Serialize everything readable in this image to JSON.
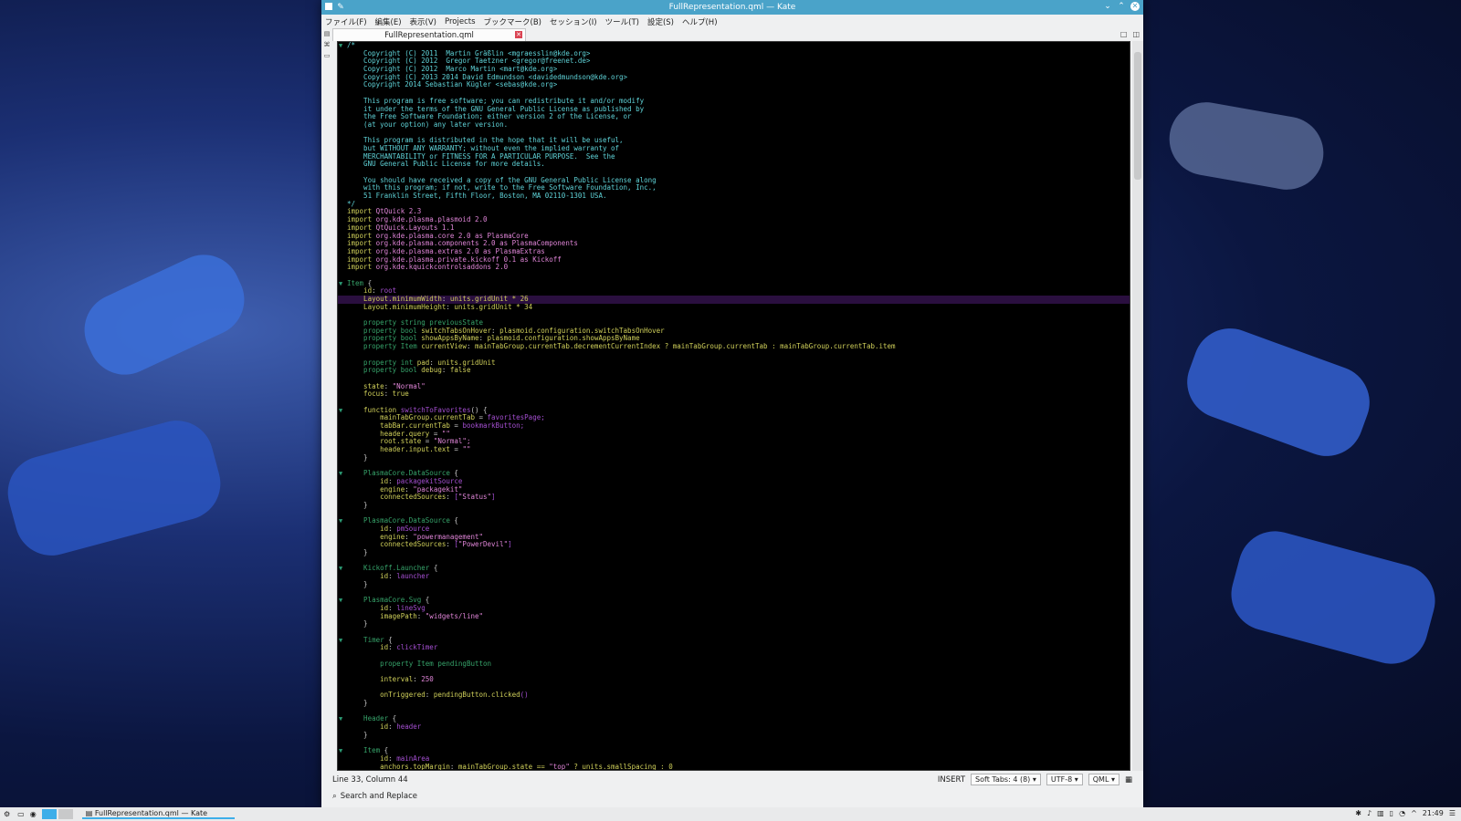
{
  "window": {
    "title": "FullRepresentation.qml — Kate"
  },
  "menu": [
    "ファイル(F)",
    "編集(E)",
    "表示(V)",
    "Projects",
    "ブックマーク(B)",
    "セッション(I)",
    "ツール(T)",
    "設定(S)",
    "ヘルプ(H)"
  ],
  "tab": {
    "label": "FullRepresentation.qml"
  },
  "code_lines": [
    {
      "fold": true,
      "cur": false,
      "segs": [
        {
          "c": "c",
          "t": "/*"
        }
      ]
    },
    {
      "segs": [
        {
          "c": "c",
          "t": "    Copyright (C) 2011  Martin Gräßlin <mgraesslin@kde.org>"
        }
      ]
    },
    {
      "segs": [
        {
          "c": "c",
          "t": "    Copyright (C) 2012  Gregor Taetzner <gregor@freenet.de>"
        }
      ]
    },
    {
      "segs": [
        {
          "c": "c",
          "t": "    Copyright (C) 2012  Marco Martin <mart@kde.org>"
        }
      ]
    },
    {
      "segs": [
        {
          "c": "c",
          "t": "    Copyright (C) 2013 2014 David Edmundson <davidedmundson@kde.org>"
        }
      ]
    },
    {
      "segs": [
        {
          "c": "c",
          "t": "    Copyright 2014 Sebastian Kügler <sebas@kde.org>"
        }
      ]
    },
    {
      "segs": [
        {
          "c": "c",
          "t": ""
        }
      ]
    },
    {
      "segs": [
        {
          "c": "c",
          "t": "    This program is free software; you can redistribute it and/or modify"
        }
      ]
    },
    {
      "segs": [
        {
          "c": "c",
          "t": "    it under the terms of the GNU General Public License as published by"
        }
      ]
    },
    {
      "segs": [
        {
          "c": "c",
          "t": "    the Free Software Foundation; either version 2 of the License, or"
        }
      ]
    },
    {
      "segs": [
        {
          "c": "c",
          "t": "    (at your option) any later version."
        }
      ]
    },
    {
      "segs": [
        {
          "c": "c",
          "t": ""
        }
      ]
    },
    {
      "segs": [
        {
          "c": "c",
          "t": "    This program is distributed in the hope that it will be useful,"
        }
      ]
    },
    {
      "segs": [
        {
          "c": "c",
          "t": "    but WITHOUT ANY WARRANTY; without even the implied warranty of"
        }
      ]
    },
    {
      "segs": [
        {
          "c": "c",
          "t": "    MERCHANTABILITY or FITNESS FOR A PARTICULAR PURPOSE.  See the"
        }
      ]
    },
    {
      "segs": [
        {
          "c": "c",
          "t": "    GNU General Public License for more details."
        }
      ]
    },
    {
      "segs": [
        {
          "c": "c",
          "t": ""
        }
      ]
    },
    {
      "segs": [
        {
          "c": "c",
          "t": "    You should have received a copy of the GNU General Public License along"
        }
      ]
    },
    {
      "segs": [
        {
          "c": "c",
          "t": "    with this program; if not, write to the Free Software Foundation, Inc.,"
        }
      ]
    },
    {
      "segs": [
        {
          "c": "c",
          "t": "    51 Franklin Street, Fifth Floor, Boston, MA 02110-1301 USA."
        }
      ]
    },
    {
      "segs": [
        {
          "c": "c",
          "t": "*/"
        }
      ]
    },
    {
      "segs": [
        {
          "c": "k",
          "t": "import "
        },
        {
          "c": "s",
          "t": "QtQuick 2.3"
        }
      ]
    },
    {
      "segs": [
        {
          "c": "k",
          "t": "import "
        },
        {
          "c": "s",
          "t": "org.kde.plasma.plasmoid 2.0"
        }
      ]
    },
    {
      "segs": [
        {
          "c": "k",
          "t": "import "
        },
        {
          "c": "s",
          "t": "QtQuick.Layouts 1.1"
        }
      ]
    },
    {
      "segs": [
        {
          "c": "k",
          "t": "import "
        },
        {
          "c": "s",
          "t": "org.kde.plasma.core 2.0 as PlasmaCore"
        }
      ]
    },
    {
      "segs": [
        {
          "c": "k",
          "t": "import "
        },
        {
          "c": "s",
          "t": "org.kde.plasma.components 2.0 as PlasmaComponents"
        }
      ]
    },
    {
      "segs": [
        {
          "c": "k",
          "t": "import "
        },
        {
          "c": "s",
          "t": "org.kde.plasma.extras 2.0 as PlasmaExtras"
        }
      ]
    },
    {
      "segs": [
        {
          "c": "k",
          "t": "import "
        },
        {
          "c": "s",
          "t": "org.kde.plasma.private.kickoff 0.1 as Kickoff"
        }
      ]
    },
    {
      "segs": [
        {
          "c": "k",
          "t": "import "
        },
        {
          "c": "s",
          "t": "org.kde.kquickcontrolsaddons 2.0"
        }
      ]
    },
    {
      "segs": [
        {
          "c": "w",
          "t": ""
        }
      ]
    },
    {
      "fold": true,
      "segs": [
        {
          "c": "g",
          "t": "Item "
        },
        {
          "c": "w",
          "t": "{"
        }
      ]
    },
    {
      "segs": [
        {
          "c": "k",
          "t": "    id"
        },
        {
          "c": "w",
          "t": ": "
        },
        {
          "c": "p",
          "t": "root"
        }
      ]
    },
    {
      "cur": true,
      "segs": [
        {
          "c": "k",
          "t": "    Layout.minimumWidth"
        },
        {
          "c": "w",
          "t": ": "
        },
        {
          "c": "k",
          "t": "units.gridUnit * 26"
        }
      ]
    },
    {
      "segs": [
        {
          "c": "k",
          "t": "    Layout.minimumHeight"
        },
        {
          "c": "w",
          "t": ": "
        },
        {
          "c": "k",
          "t": "units.gridUnit * 34"
        }
      ]
    },
    {
      "segs": [
        {
          "c": "w",
          "t": ""
        }
      ]
    },
    {
      "segs": [
        {
          "c": "g",
          "t": "    property string previousState"
        }
      ]
    },
    {
      "segs": [
        {
          "c": "g",
          "t": "    property bool "
        },
        {
          "c": "k",
          "t": "switchTabsOnHover"
        },
        {
          "c": "w",
          "t": ": "
        },
        {
          "c": "k",
          "t": "plasmoid.configuration.switchTabsOnHover"
        }
      ]
    },
    {
      "segs": [
        {
          "c": "g",
          "t": "    property bool "
        },
        {
          "c": "k",
          "t": "showAppsByName"
        },
        {
          "c": "w",
          "t": ": "
        },
        {
          "c": "k",
          "t": "plasmoid.configuration.showAppsByName"
        }
      ]
    },
    {
      "segs": [
        {
          "c": "g",
          "t": "    property Item "
        },
        {
          "c": "k",
          "t": "currentView"
        },
        {
          "c": "w",
          "t": ": "
        },
        {
          "c": "k",
          "t": "mainTabGroup.currentTab.decrementCurrentIndex ? mainTabGroup.currentTab : mainTabGroup.currentTab.item"
        }
      ]
    },
    {
      "segs": [
        {
          "c": "w",
          "t": ""
        }
      ]
    },
    {
      "segs": [
        {
          "c": "g",
          "t": "    property int "
        },
        {
          "c": "k",
          "t": "pad"
        },
        {
          "c": "w",
          "t": ": "
        },
        {
          "c": "k",
          "t": "units.gridUnit"
        }
      ]
    },
    {
      "segs": [
        {
          "c": "g",
          "t": "    property bool "
        },
        {
          "c": "k",
          "t": "debug"
        },
        {
          "c": "w",
          "t": ": "
        },
        {
          "c": "k",
          "t": "false"
        }
      ]
    },
    {
      "segs": [
        {
          "c": "w",
          "t": ""
        }
      ]
    },
    {
      "segs": [
        {
          "c": "k",
          "t": "    state"
        },
        {
          "c": "w",
          "t": ": "
        },
        {
          "c": "s",
          "t": "\"Normal\""
        }
      ]
    },
    {
      "segs": [
        {
          "c": "k",
          "t": "    focus"
        },
        {
          "c": "w",
          "t": ": "
        },
        {
          "c": "k",
          "t": "true"
        }
      ]
    },
    {
      "segs": [
        {
          "c": "w",
          "t": ""
        }
      ]
    },
    {
      "fold": true,
      "segs": [
        {
          "c": "k",
          "t": "    function "
        },
        {
          "c": "p",
          "t": "switchToFavorites"
        },
        {
          "c": "w",
          "t": "() {"
        }
      ]
    },
    {
      "segs": [
        {
          "c": "k",
          "t": "        mainTabGroup.currentTab"
        },
        {
          "c": "w",
          "t": " = "
        },
        {
          "c": "p",
          "t": "favoritesPage;"
        }
      ]
    },
    {
      "segs": [
        {
          "c": "k",
          "t": "        tabBar.currentTab"
        },
        {
          "c": "w",
          "t": " = "
        },
        {
          "c": "p",
          "t": "bookmarkButton;"
        }
      ]
    },
    {
      "segs": [
        {
          "c": "k",
          "t": "        header.query"
        },
        {
          "c": "w",
          "t": " = "
        },
        {
          "c": "s",
          "t": "\"\""
        }
      ]
    },
    {
      "segs": [
        {
          "c": "k",
          "t": "        root.state"
        },
        {
          "c": "w",
          "t": " = "
        },
        {
          "c": "s",
          "t": "\"Normal\";"
        }
      ]
    },
    {
      "segs": [
        {
          "c": "k",
          "t": "        header.input.text"
        },
        {
          "c": "w",
          "t": " = "
        },
        {
          "c": "s",
          "t": "\"\""
        }
      ]
    },
    {
      "segs": [
        {
          "c": "w",
          "t": "    }"
        }
      ]
    },
    {
      "segs": [
        {
          "c": "w",
          "t": ""
        }
      ]
    },
    {
      "fold": true,
      "segs": [
        {
          "c": "g",
          "t": "    PlasmaCore.DataSource "
        },
        {
          "c": "w",
          "t": "{"
        }
      ]
    },
    {
      "segs": [
        {
          "c": "k",
          "t": "        id"
        },
        {
          "c": "w",
          "t": ": "
        },
        {
          "c": "p",
          "t": "packagekitSource"
        }
      ]
    },
    {
      "segs": [
        {
          "c": "k",
          "t": "        engine"
        },
        {
          "c": "w",
          "t": ": "
        },
        {
          "c": "s",
          "t": "\"packagekit\""
        }
      ]
    },
    {
      "segs": [
        {
          "c": "k",
          "t": "        connectedSources"
        },
        {
          "c": "w",
          "t": ": "
        },
        {
          "c": "p",
          "t": "["
        },
        {
          "c": "s",
          "t": "\"Status\""
        },
        {
          "c": "p",
          "t": "]"
        }
      ]
    },
    {
      "segs": [
        {
          "c": "w",
          "t": "    }"
        }
      ]
    },
    {
      "segs": [
        {
          "c": "w",
          "t": ""
        }
      ]
    },
    {
      "fold": true,
      "segs": [
        {
          "c": "g",
          "t": "    PlasmaCore.DataSource "
        },
        {
          "c": "w",
          "t": "{"
        }
      ]
    },
    {
      "segs": [
        {
          "c": "k",
          "t": "        id"
        },
        {
          "c": "w",
          "t": ": "
        },
        {
          "c": "p",
          "t": "pmSource"
        }
      ]
    },
    {
      "segs": [
        {
          "c": "k",
          "t": "        engine"
        },
        {
          "c": "w",
          "t": ": "
        },
        {
          "c": "s",
          "t": "\"powermanagement\""
        }
      ]
    },
    {
      "segs": [
        {
          "c": "k",
          "t": "        connectedSources"
        },
        {
          "c": "w",
          "t": ": "
        },
        {
          "c": "p",
          "t": "["
        },
        {
          "c": "s",
          "t": "\"PowerDevil\""
        },
        {
          "c": "p",
          "t": "]"
        }
      ]
    },
    {
      "segs": [
        {
          "c": "w",
          "t": "    }"
        }
      ]
    },
    {
      "segs": [
        {
          "c": "w",
          "t": ""
        }
      ]
    },
    {
      "fold": true,
      "segs": [
        {
          "c": "g",
          "t": "    Kickoff.Launcher "
        },
        {
          "c": "w",
          "t": "{"
        }
      ]
    },
    {
      "segs": [
        {
          "c": "k",
          "t": "        id"
        },
        {
          "c": "w",
          "t": ": "
        },
        {
          "c": "p",
          "t": "launcher"
        }
      ]
    },
    {
      "segs": [
        {
          "c": "w",
          "t": "    }"
        }
      ]
    },
    {
      "segs": [
        {
          "c": "w",
          "t": ""
        }
      ]
    },
    {
      "fold": true,
      "segs": [
        {
          "c": "g",
          "t": "    PlasmaCore.Svg "
        },
        {
          "c": "w",
          "t": "{"
        }
      ]
    },
    {
      "segs": [
        {
          "c": "k",
          "t": "        id"
        },
        {
          "c": "w",
          "t": ": "
        },
        {
          "c": "p",
          "t": "lineSvg"
        }
      ]
    },
    {
      "segs": [
        {
          "c": "k",
          "t": "        imagePath"
        },
        {
          "c": "w",
          "t": ": "
        },
        {
          "c": "s",
          "t": "\"widgets/line\""
        }
      ]
    },
    {
      "segs": [
        {
          "c": "w",
          "t": "    }"
        }
      ]
    },
    {
      "segs": [
        {
          "c": "w",
          "t": ""
        }
      ]
    },
    {
      "fold": true,
      "segs": [
        {
          "c": "g",
          "t": "    Timer "
        },
        {
          "c": "w",
          "t": "{"
        }
      ]
    },
    {
      "segs": [
        {
          "c": "k",
          "t": "        id"
        },
        {
          "c": "w",
          "t": ": "
        },
        {
          "c": "p",
          "t": "clickTimer"
        }
      ]
    },
    {
      "segs": [
        {
          "c": "w",
          "t": ""
        }
      ]
    },
    {
      "segs": [
        {
          "c": "g",
          "t": "        property Item pendingButton"
        }
      ]
    },
    {
      "segs": [
        {
          "c": "w",
          "t": ""
        }
      ]
    },
    {
      "segs": [
        {
          "c": "k",
          "t": "        interval"
        },
        {
          "c": "w",
          "t": ": "
        },
        {
          "c": "s",
          "t": "250"
        }
      ]
    },
    {
      "segs": [
        {
          "c": "w",
          "t": ""
        }
      ]
    },
    {
      "segs": [
        {
          "c": "k",
          "t": "        onTriggered"
        },
        {
          "c": "w",
          "t": ": "
        },
        {
          "c": "k",
          "t": "pendingButton.clicked"
        },
        {
          "c": "p",
          "t": "()"
        }
      ]
    },
    {
      "segs": [
        {
          "c": "w",
          "t": "    }"
        }
      ]
    },
    {
      "segs": [
        {
          "c": "w",
          "t": ""
        }
      ]
    },
    {
      "fold": true,
      "segs": [
        {
          "c": "g",
          "t": "    Header "
        },
        {
          "c": "w",
          "t": "{"
        }
      ]
    },
    {
      "segs": [
        {
          "c": "k",
          "t": "        id"
        },
        {
          "c": "w",
          "t": ": "
        },
        {
          "c": "p",
          "t": "header"
        }
      ]
    },
    {
      "segs": [
        {
          "c": "w",
          "t": "    }"
        }
      ]
    },
    {
      "segs": [
        {
          "c": "w",
          "t": ""
        }
      ]
    },
    {
      "fold": true,
      "segs": [
        {
          "c": "g",
          "t": "    Item "
        },
        {
          "c": "w",
          "t": "{"
        }
      ]
    },
    {
      "segs": [
        {
          "c": "k",
          "t": "        id"
        },
        {
          "c": "w",
          "t": ": "
        },
        {
          "c": "p",
          "t": "mainArea"
        }
      ]
    },
    {
      "segs": [
        {
          "c": "k",
          "t": "        anchors.topMargin"
        },
        {
          "c": "w",
          "t": ": "
        },
        {
          "c": "k",
          "t": "mainTabGroup.state == "
        },
        {
          "c": "s",
          "t": "\"top\""
        },
        {
          "c": "k",
          "t": " ? units.smallSpacing : 0"
        }
      ]
    }
  ],
  "status": {
    "position": "Line 33, Column 44",
    "mode": "INSERT",
    "tabs": "Soft Tabs: 4 (8)",
    "encoding": "UTF-8",
    "syntax": "QML"
  },
  "search": {
    "label": "Search and Replace"
  },
  "taskbar": {
    "task": "FullRepresentation.qml — Kate",
    "clock": "21:49"
  },
  "colors": {
    "titlebar": "#4aa3c9",
    "editor_bg": "#000000",
    "current_line": "#2a0f3f"
  }
}
